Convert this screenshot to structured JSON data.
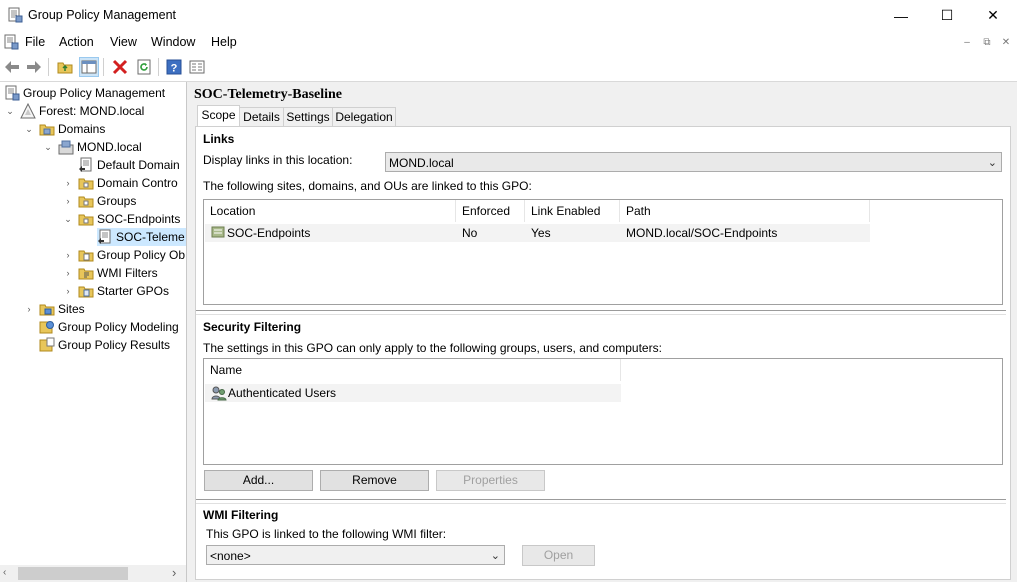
{
  "window": {
    "title": "Group Policy Management",
    "minimize_glyph": "—",
    "maximize_glyph": "☐",
    "close_glyph": "✕"
  },
  "menu": {
    "items": [
      "File",
      "Action",
      "View",
      "Window",
      "Help"
    ]
  },
  "mdi": {
    "min": "–",
    "restore": "⧉",
    "close": "✕"
  },
  "toolbar": {
    "icons": [
      "back-arrow-icon",
      "forward-arrow-icon",
      "up-folder-icon",
      "show-hide-tree-icon",
      "delete-icon",
      "refresh-icon",
      "help-icon",
      "properties-icon"
    ]
  },
  "tree": {
    "items": [
      {
        "label": "Group Policy Management",
        "icon": "gpm-root-icon"
      },
      {
        "label": "Forest: MOND.local",
        "icon": "forest-icon"
      },
      {
        "label": "Domains",
        "icon": "domains-folder-icon"
      },
      {
        "label": "MOND.local",
        "icon": "domain-icon"
      },
      {
        "label": "Default Domain",
        "icon": "gpo-link-icon"
      },
      {
        "label": "Domain Contro",
        "icon": "ou-folder-icon"
      },
      {
        "label": "Groups",
        "icon": "ou-folder-icon"
      },
      {
        "label": "SOC-Endpoints",
        "icon": "ou-folder-icon"
      },
      {
        "label": "SOC-Teleme",
        "icon": "gpo-link-icon"
      },
      {
        "label": "Group Policy Ob",
        "icon": "gpo-folder-icon"
      },
      {
        "label": "WMI Filters",
        "icon": "wmi-folder-icon"
      },
      {
        "label": "Starter GPOs",
        "icon": "starter-folder-icon"
      },
      {
        "label": "Sites",
        "icon": "sites-icon"
      },
      {
        "label": "Group Policy Modeling",
        "icon": "modeling-icon"
      },
      {
        "label": "Group Policy Results",
        "icon": "results-icon"
      }
    ]
  },
  "gpo": {
    "name": "SOC-Telemetry-Baseline",
    "tabs": [
      "Scope",
      "Details",
      "Settings",
      "Delegation"
    ],
    "links": {
      "heading": "Links",
      "display_label": "Display links in this location:",
      "display_value": "MOND.local",
      "linked_label": "The following sites, domains, and OUs are linked to this GPO:",
      "columns": [
        "Location",
        "Enforced",
        "Link Enabled",
        "Path"
      ],
      "rows": [
        {
          "location": "SOC-Endpoints",
          "enforced": "No",
          "link_enabled": "Yes",
          "path": "MOND.local/SOC-Endpoints"
        }
      ]
    },
    "security": {
      "heading": "Security Filtering",
      "description": "The settings in this GPO can only apply to the following groups, users, and computers:",
      "column": "Name",
      "rows": [
        "Authenticated Users"
      ],
      "add_label": "Add...",
      "remove_label": "Remove",
      "properties_label": "Properties"
    },
    "wmi": {
      "heading": "WMI Filtering",
      "description": "This GPO is linked to the following WMI filter:",
      "filter_value": "<none>",
      "open_label": "Open"
    }
  }
}
